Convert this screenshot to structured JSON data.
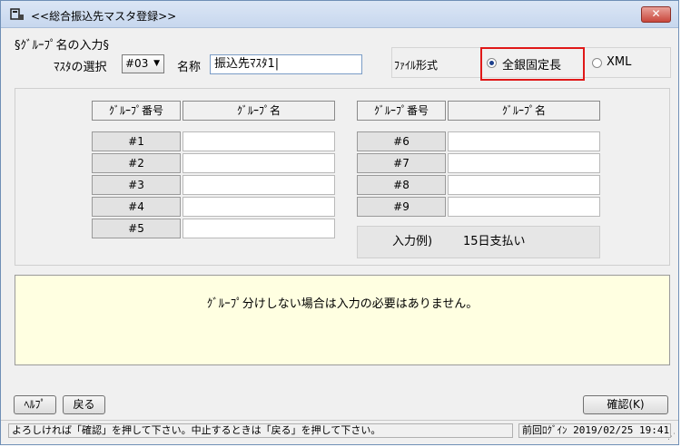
{
  "window": {
    "title": "<<総合振込先マスタ登録>>",
    "icon": "app-icon",
    "close_label": "✕"
  },
  "section": {
    "label": "§ｸﾞﾙｰﾌﾟ名の入力§"
  },
  "master": {
    "label": "ﾏｽﾀの選択",
    "selected": "#03",
    "name_label": "名称",
    "name_value": "振込先ﾏｽﾀ1|"
  },
  "file_format": {
    "label": "ﾌｧｲﾙ形式",
    "options": [
      {
        "label": "全銀固定長",
        "checked": true
      },
      {
        "label": "XML",
        "checked": false
      }
    ]
  },
  "groups": {
    "header_number": "ｸﾞﾙｰﾌﾟ番号",
    "header_name": "ｸﾞﾙｰﾌﾟ名",
    "left": [
      {
        "number": "#1",
        "name": ""
      },
      {
        "number": "#2",
        "name": ""
      },
      {
        "number": "#3",
        "name": ""
      },
      {
        "number": "#4",
        "name": ""
      },
      {
        "number": "#5",
        "name": ""
      }
    ],
    "right": [
      {
        "number": "#6",
        "name": ""
      },
      {
        "number": "#7",
        "name": ""
      },
      {
        "number": "#8",
        "name": ""
      },
      {
        "number": "#9",
        "name": ""
      }
    ],
    "example_label": "入力例)",
    "example_value": "15日支払い"
  },
  "message": "ｸﾞﾙｰﾌﾟ分けしない場合は入力の必要はありません。",
  "buttons": {
    "help": "ﾍﾙﾌﾟ",
    "back": "戻る",
    "confirm": "確認(K)"
  },
  "status": {
    "message": "よろしければ「確認」を押して下さい。中止するときは「戻る」を押して下さい。",
    "login": "前回ﾛｸﾞｲﾝ 2019/02/25 19:41"
  }
}
